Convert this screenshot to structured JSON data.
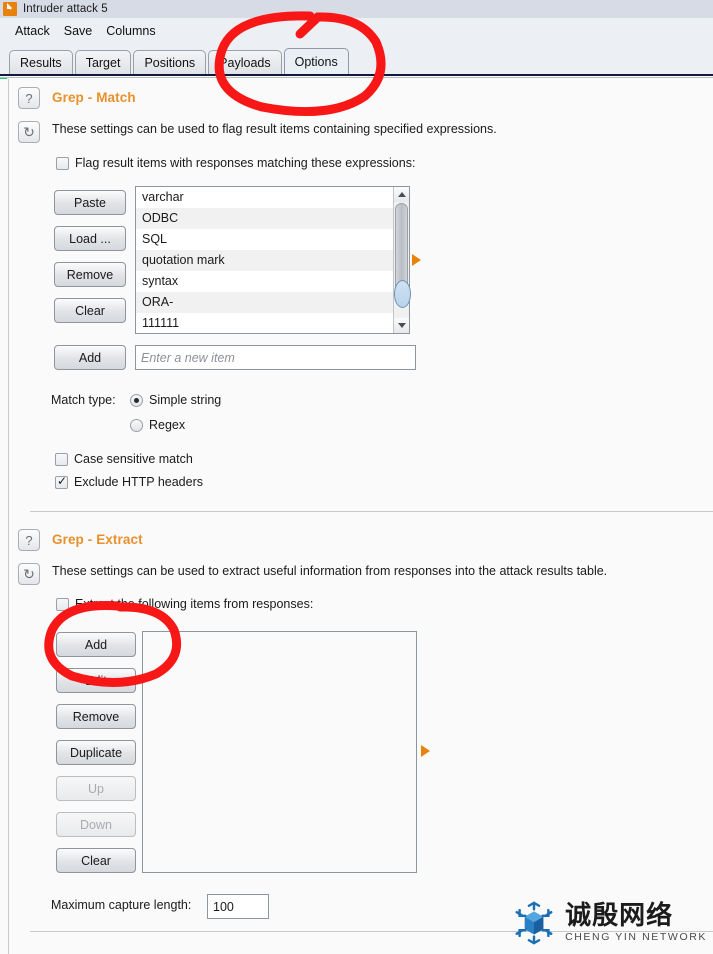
{
  "window": {
    "title": "Intruder attack 5",
    "icon": "burp-suite-icon"
  },
  "menubar": {
    "items": [
      {
        "label": "Attack"
      },
      {
        "label": "Save"
      },
      {
        "label": "Columns"
      }
    ]
  },
  "tabs": [
    {
      "label": "Results",
      "selected": false
    },
    {
      "label": "Target",
      "selected": false
    },
    {
      "label": "Positions",
      "selected": false
    },
    {
      "label": "Payloads",
      "selected": false
    },
    {
      "label": "Options",
      "selected": true
    }
  ],
  "grep_match": {
    "title": "Grep - Match",
    "description": "These settings can be used to flag result items containing specified expressions.",
    "help_label": "?",
    "reset_label": "↻",
    "flag_checkbox": {
      "label": "Flag result items with responses matching these expressions:",
      "checked": false
    },
    "buttons": [
      {
        "label": "Paste",
        "enabled": true
      },
      {
        "label": "Load ...",
        "enabled": true
      },
      {
        "label": "Remove",
        "enabled": true
      },
      {
        "label": "Clear",
        "enabled": true
      }
    ],
    "list_items": [
      "varchar",
      "ODBC",
      "SQL",
      "quotation mark",
      "syntax",
      "ORA-",
      "111111"
    ],
    "add_button": "Add",
    "new_item_placeholder": "Enter a new item",
    "new_item_value": "",
    "match_type_label": "Match type:",
    "match_type_options": [
      {
        "label": "Simple string",
        "selected": true
      },
      {
        "label": "Regex",
        "selected": false
      }
    ],
    "case_sensitive": {
      "label": "Case sensitive match",
      "checked": false
    },
    "exclude_headers": {
      "label": "Exclude HTTP headers",
      "checked": true
    }
  },
  "grep_extract": {
    "title": "Grep - Extract",
    "description": "These settings can be used to extract useful information from responses into the attack results table.",
    "help_label": "?",
    "reset_label": "↻",
    "extract_checkbox": {
      "label": "Extract the following items from responses:",
      "checked": false
    },
    "buttons": [
      {
        "label": "Add",
        "enabled": true
      },
      {
        "label": "Edit",
        "enabled": true
      },
      {
        "label": "Remove",
        "enabled": true
      },
      {
        "label": "Duplicate",
        "enabled": true
      },
      {
        "label": "Up",
        "enabled": false
      },
      {
        "label": "Down",
        "enabled": false
      },
      {
        "label": "Clear",
        "enabled": true
      }
    ],
    "list_items": [],
    "max_capture_label": "Maximum capture length:",
    "max_capture_value": "100"
  },
  "watermark": {
    "cn": "诚殷网络",
    "en": "CHENG YIN NETWORK",
    "icon": "cheng-yin-logo-icon"
  },
  "annotations": [
    {
      "name": "options-tab-highlight",
      "color": "#f71717"
    },
    {
      "name": "add-button-highlight",
      "color": "#f71717"
    }
  ],
  "colors": {
    "accent_orange": "#e8912c",
    "green_accent": "#16d07e",
    "annotation_red": "#f71717",
    "tab_selected": "#e9eff5"
  }
}
